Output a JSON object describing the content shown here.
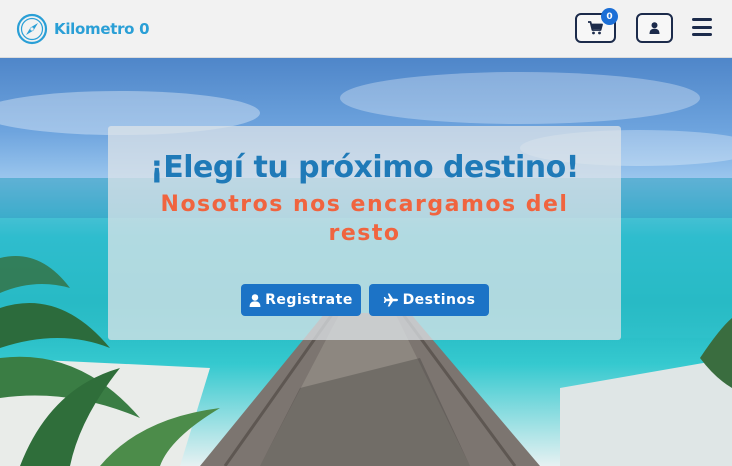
{
  "navbar": {
    "brand_name": "Kilometro 0",
    "brand_icon": "compass-icon",
    "cart_count": "0",
    "cart_icon": "shopping-cart-icon",
    "user_icon": "user-icon",
    "menu_icon": "hamburger-menu-icon"
  },
  "hero": {
    "title": "¡Elegí tu próximo destino!",
    "subtitle": "Nosotros nos encargamos del resto",
    "buttons": [
      {
        "label": "Registrate",
        "icon": "user-icon"
      },
      {
        "label": "Destinos",
        "icon": "plane-icon"
      }
    ]
  },
  "colors": {
    "brand": "#2a9fd6",
    "title": "#1f7ab8",
    "subtitle": "#f0643f",
    "button": "#1c73c6",
    "nav_border": "#1c2b4b"
  }
}
